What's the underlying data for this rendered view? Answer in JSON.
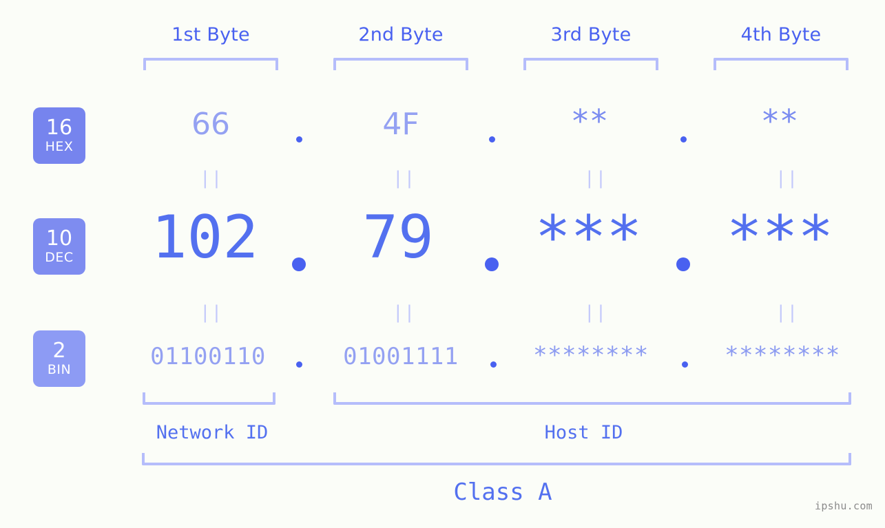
{
  "theme": {
    "background": "#fbfdf8",
    "accent_strong": "#4961f0",
    "accent_mid": "#5370ef",
    "accent_light": "#94a1f2",
    "bracket": "#b5bdfb",
    "connector": "#c3c9fb",
    "badge_hex_bg": "#7684ee",
    "badge_dec_bg": "#7e8cf0",
    "badge_bin_bg": "#8d9bf4",
    "watermark": "#8b8b8b"
  },
  "headers": [
    {
      "label": "1st Byte"
    },
    {
      "label": "2nd Byte"
    },
    {
      "label": "3rd Byte"
    },
    {
      "label": "4th Byte"
    }
  ],
  "rows": [
    {
      "key": "hex",
      "badge": {
        "number": "16",
        "word": "HEX"
      },
      "values": [
        "66",
        "4F",
        "**",
        "**"
      ],
      "separator": "."
    },
    {
      "key": "dec",
      "badge": {
        "number": "10",
        "word": "DEC"
      },
      "values": [
        "102",
        "79",
        "***",
        "***"
      ],
      "separator": "."
    },
    {
      "key": "bin",
      "badge": {
        "number": "2",
        "word": "BIN"
      },
      "values": [
        "01100110",
        "01001111",
        "********",
        "********"
      ],
      "separator": "."
    }
  ],
  "connectors": {
    "glyph": "||",
    "count_per_row": 4
  },
  "segments": [
    {
      "name": "network",
      "label": "Network ID"
    },
    {
      "name": "host",
      "label": "Host ID"
    }
  ],
  "class": {
    "label": "Class A"
  },
  "watermark": {
    "text": "ipshu.com"
  }
}
